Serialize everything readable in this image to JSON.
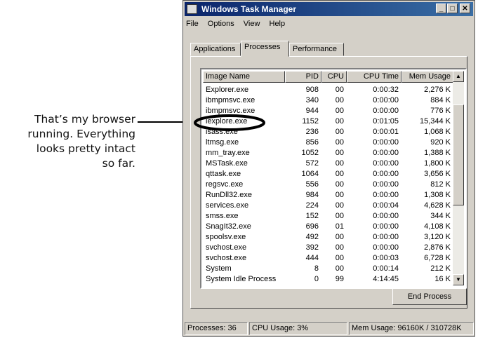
{
  "annotation": {
    "lines": [
      "That’s my browser",
      "running. Everything",
      "looks pretty intact",
      "so far."
    ]
  },
  "window": {
    "title": "Windows Task Manager",
    "controls": {
      "minimize": "_",
      "maximize": "□",
      "close": "✕"
    },
    "menu": [
      "File",
      "Options",
      "View",
      "Help"
    ],
    "tabs": [
      "Applications",
      "Processes",
      "Performance"
    ],
    "active_tab": "Processes",
    "columns": [
      "Image Name",
      "PID",
      "CPU",
      "CPU Time",
      "Mem Usage"
    ],
    "processes": [
      [
        "Explorer.exe",
        "908",
        "00",
        "0:00:32",
        "2,276 K"
      ],
      [
        "ibmpmsvc.exe",
        "340",
        "00",
        "0:00:00",
        "884 K"
      ],
      [
        "ibmpmsvc.exe",
        "944",
        "00",
        "0:00:00",
        "776 K"
      ],
      [
        "iexplore.exe",
        "1152",
        "00",
        "0:01:05",
        "15,344 K"
      ],
      [
        "isass.exe",
        "236",
        "00",
        "0:00:01",
        "1,068 K"
      ],
      [
        "ltmsg.exe",
        "856",
        "00",
        "0:00:00",
        "920 K"
      ],
      [
        "mm_tray.exe",
        "1052",
        "00",
        "0:00:00",
        "1,388 K"
      ],
      [
        "MSTask.exe",
        "572",
        "00",
        "0:00:00",
        "1,800 K"
      ],
      [
        "qttask.exe",
        "1064",
        "00",
        "0:00:00",
        "3,656 K"
      ],
      [
        "regsvc.exe",
        "556",
        "00",
        "0:00:00",
        "812 K"
      ],
      [
        "RunDll32.exe",
        "984",
        "00",
        "0:00:00",
        "1,308 K"
      ],
      [
        "services.exe",
        "224",
        "00",
        "0:00:04",
        "4,628 K"
      ],
      [
        "smss.exe",
        "152",
        "00",
        "0:00:00",
        "344 K"
      ],
      [
        "SnagIt32.exe",
        "696",
        "01",
        "0:00:00",
        "4,108 K"
      ],
      [
        "spoolsv.exe",
        "492",
        "00",
        "0:00:00",
        "3,120 K"
      ],
      [
        "svchost.exe",
        "392",
        "00",
        "0:00:00",
        "2,876 K"
      ],
      [
        "svchost.exe",
        "444",
        "00",
        "0:00:03",
        "6,728 K"
      ],
      [
        "System",
        "8",
        "00",
        "0:00:14",
        "212 K"
      ],
      [
        "System Idle Process",
        "0",
        "99",
        "4:14:45",
        "16 K"
      ]
    ],
    "highlighted_process": "iexplore.exe",
    "end_process_label": "End Process",
    "status": {
      "processes": "Processes: 36",
      "cpu": "CPU Usage: 3%",
      "mem": "Mem Usage: 96160K / 310728K"
    }
  }
}
